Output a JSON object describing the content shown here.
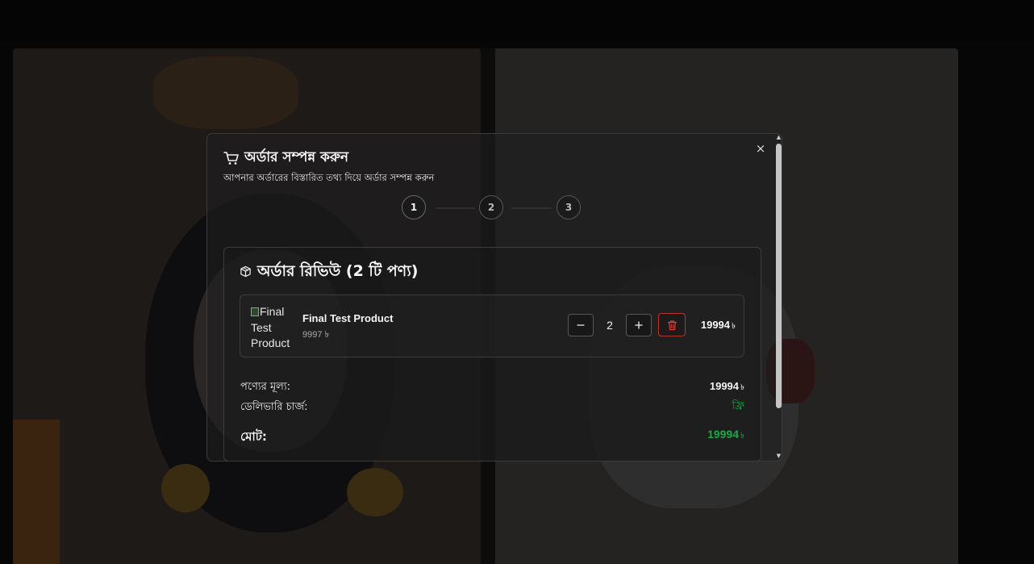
{
  "modal": {
    "title": "অর্ডার সম্পন্ন করুন",
    "subtitle": "আপনার অর্ডারের বিস্তারিত তথ্য দিয়ে অর্ডার সম্পন্ন করুন",
    "close_label": "×"
  },
  "steps": [
    {
      "label": "1",
      "active": true
    },
    {
      "label": "2",
      "active": false
    },
    {
      "label": "3",
      "active": false
    }
  ],
  "review": {
    "title": "অর্ডার রিভিউ (2 টি পণ্য)",
    "items": [
      {
        "image_alt": "Final Test Product",
        "name": "Final Test Product",
        "unit_price": "9997 ৳",
        "quantity": "2",
        "total": "19994",
        "currency": "৳"
      }
    ],
    "summary": {
      "subtotal_label": "পণ্যের মূল্য:",
      "subtotal_value": "19994",
      "delivery_label": "ডেলিভারি চার্জ:",
      "delivery_value": "ফ্রি",
      "total_label": "মোট:",
      "total_value": "19994",
      "currency": "৳"
    }
  },
  "icons": {
    "cart": "cart-icon",
    "package": "package-icon",
    "minus": "minus-icon",
    "plus": "plus-icon",
    "trash": "trash-icon",
    "close": "close-icon"
  },
  "colors": {
    "accent_green": "#1fa54a",
    "danger_red": "#b2362f"
  }
}
